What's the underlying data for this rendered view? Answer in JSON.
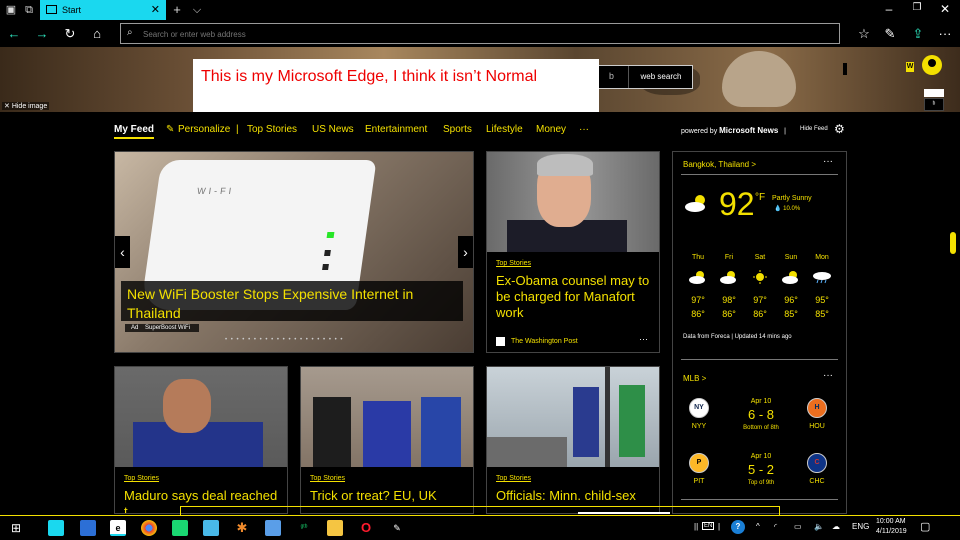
{
  "browser": {
    "tab_title": "Start",
    "address_placeholder": "Search or enter web address"
  },
  "hero": {
    "hide_image": "Hide image",
    "web_search": "web search",
    "annotation": "This is my Microsoft Edge, I think it isn’t Normal",
    "user_initial": "W"
  },
  "feed_nav": {
    "items": [
      "My Feed",
      "Personalize",
      "Top Stories",
      "US News",
      "Entertainment",
      "Sports",
      "Lifestyle",
      "Money",
      "···"
    ],
    "powered_by_prefix": "powered by ",
    "powered_by_brand": "Microsoft News",
    "hide_feed": "Hide Feed"
  },
  "cards": {
    "main": {
      "headline": "New WiFi Booster Stops Expensive Internet in Thailand",
      "ad_tag": "Ad",
      "sponsor": "SuperBoost WiFi",
      "device_text": "WI-FI",
      "dots": "• • • • • • • • • • • • • • • • • • • • •"
    },
    "right": {
      "category": "Top Stories",
      "headline": "Ex-Obama counsel may to be charged for Manafort work",
      "source": "The Washington Post",
      "more": "···"
    },
    "b1": {
      "category": "Top Stories",
      "headline": "Maduro says deal reached t"
    },
    "b2": {
      "category": "Top Stories",
      "headline": "Trick or treat? EU, UK"
    },
    "b3": {
      "category": "Top Stories",
      "headline": "Officials: Minn. child-sex"
    }
  },
  "weather": {
    "city": "Bangkok, Thailand >",
    "more": "···",
    "temp": "92",
    "unit": "°F",
    "condition": "Partly Sunny",
    "precip": "💧 10.0%",
    "days": [
      {
        "name": "Thu",
        "hi": "97°",
        "lo": "86°",
        "icon": "partly-sunny-icon"
      },
      {
        "name": "Fri",
        "hi": "98°",
        "lo": "86°",
        "icon": "partly-sunny-icon"
      },
      {
        "name": "Sat",
        "hi": "97°",
        "lo": "86°",
        "icon": "sunny-icon"
      },
      {
        "name": "Sun",
        "hi": "96°",
        "lo": "85°",
        "icon": "partly-sunny-icon"
      },
      {
        "name": "Mon",
        "hi": "95°",
        "lo": "85°",
        "icon": "rain-icon"
      }
    ],
    "source": "Data from Foreca | Updated 14 mins ago"
  },
  "mlb": {
    "title": "MLB >",
    "more": "···",
    "games": [
      {
        "date": "Apr 10",
        "score": "6 - 8",
        "status": "Bottom of 8th",
        "away": "NYY",
        "home": "HOU"
      },
      {
        "date": "Apr 10",
        "score": "5 - 2",
        "status": "Top of 9th",
        "away": "PIT",
        "home": "CHC"
      }
    ]
  },
  "taskbar": {
    "lang": "ENG",
    "tray_lang": "EN",
    "time": "10:00 AM",
    "date": "4/11/2019"
  },
  "colors": {
    "accent": "#f3e000",
    "tab_active": "#1ad8ef",
    "annotation_text": "#e00000"
  }
}
